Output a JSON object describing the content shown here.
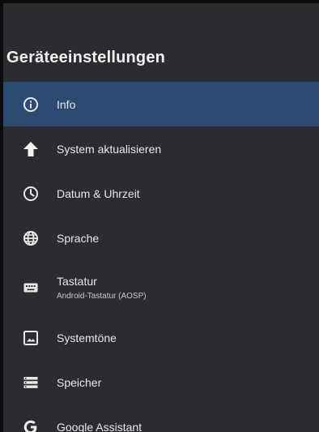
{
  "screen": {
    "title": "Geräteeinstellungen",
    "accent_color": "#2c4b71",
    "background_color": "#2a2c30"
  },
  "menu": {
    "items": [
      {
        "label": "Info",
        "icon": "info-icon",
        "selected": true
      },
      {
        "label": "System aktualisieren",
        "icon": "arrow-up-icon"
      },
      {
        "label": "Datum & Uhrzeit",
        "icon": "clock-icon"
      },
      {
        "label": "Sprache",
        "icon": "globe-icon"
      },
      {
        "label": "Tastatur",
        "sublabel": "Android-Tastatur (AOSP)",
        "icon": "keyboard-icon"
      },
      {
        "label": "Systemtöne",
        "icon": "image-icon"
      },
      {
        "label": "Speicher",
        "icon": "storage-icon"
      },
      {
        "label": "Google Assistant",
        "icon": "google-icon"
      }
    ]
  }
}
